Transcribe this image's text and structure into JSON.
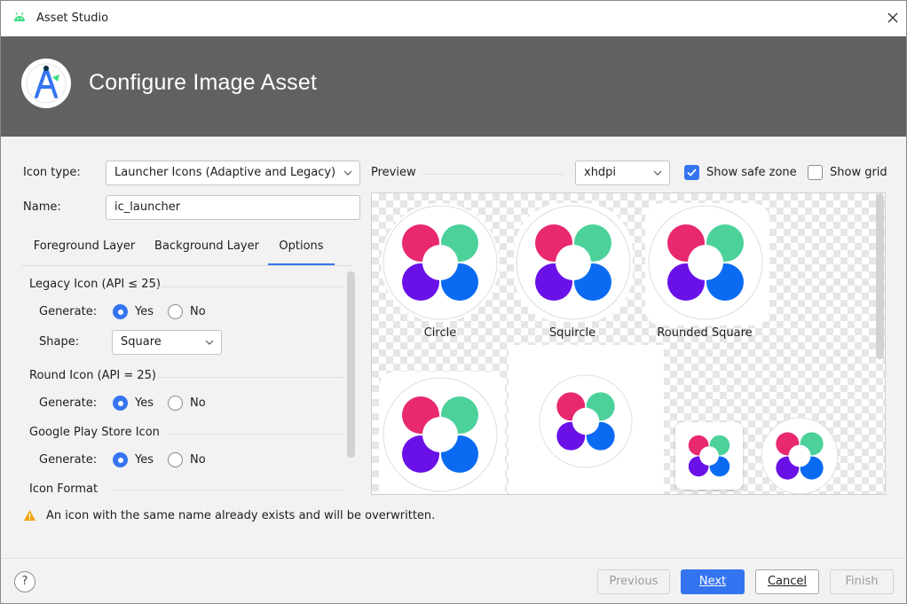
{
  "window": {
    "title": "Asset Studio"
  },
  "header": {
    "heading": "Configure Image Asset"
  },
  "form": {
    "icon_type_label": "Icon type:",
    "icon_type_value": "Launcher Icons (Adaptive and Legacy)",
    "name_label": "Name:",
    "name_value": "ic_launcher"
  },
  "tabs": [
    {
      "label": "Foreground Layer",
      "active": false
    },
    {
      "label": "Background Layer",
      "active": false
    },
    {
      "label": "Options",
      "active": true
    }
  ],
  "options": {
    "legacy": {
      "title": "Legacy Icon (API ≤ 25)",
      "generate_label": "Generate:",
      "yes": "Yes",
      "no": "No",
      "shape_label": "Shape:",
      "shape_value": "Square"
    },
    "round": {
      "title": "Round Icon (API = 25)",
      "generate_label": "Generate:",
      "yes": "Yes",
      "no": "No"
    },
    "play": {
      "title": "Google Play Store Icon",
      "generate_label": "Generate:",
      "yes": "Yes",
      "no": "No"
    },
    "format": {
      "title": "Icon Format"
    }
  },
  "preview": {
    "label": "Preview",
    "density_value": "xhdpi",
    "show_safe_zone_label": "Show safe zone",
    "show_safe_zone_checked": true,
    "show_grid_label": "Show grid",
    "show_grid_checked": false,
    "captions": [
      "Circle",
      "Squircle",
      "Rounded Square"
    ]
  },
  "warning": {
    "text": "An icon with the same name already exists and will be overwritten."
  },
  "footer": {
    "help_label": "?",
    "previous_label": "Previous",
    "next_label": "Next",
    "cancel_label": "Cancel",
    "finish_label": "Finish"
  },
  "colors": {
    "accent": "#3574f0",
    "header_bg": "#616161",
    "petal_pink": "#e8286f",
    "petal_green": "#4cd19b",
    "petal_purple": "#6a11e8",
    "petal_blue": "#0a6bf2"
  }
}
